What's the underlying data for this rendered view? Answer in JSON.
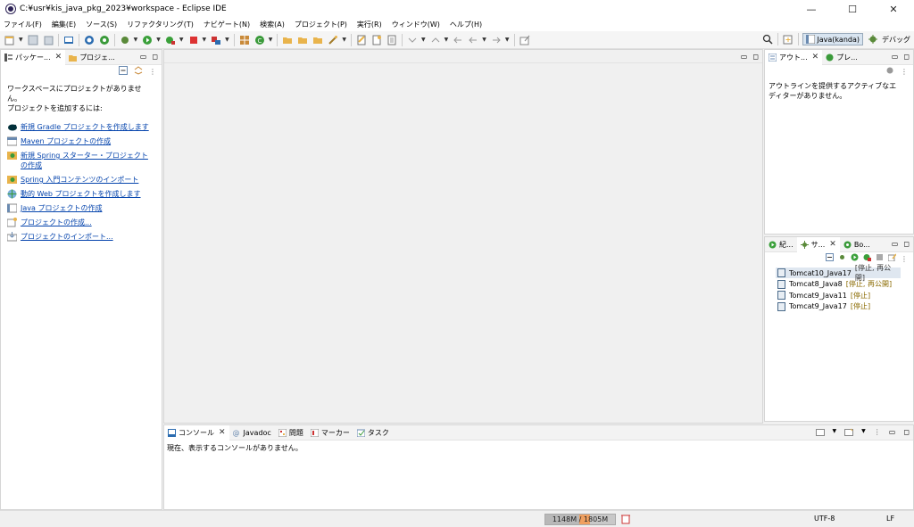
{
  "window": {
    "title": "C:¥usr¥kis_java_pkg_2023¥workspace - Eclipse IDE",
    "minimize_glyph": "—",
    "maximize_glyph": "☐",
    "close_glyph": "✕"
  },
  "menu": [
    "ファイル(F)",
    "編集(E)",
    "ソース(S)",
    "リファクタリング(T)",
    "ナビゲート(N)",
    "検索(A)",
    "プロジェクト(P)",
    "実行(R)",
    "ウィンドウ(W)",
    "ヘルプ(H)"
  ],
  "perspectives": {
    "java": "Java(kanda)",
    "debug": "デバッグ"
  },
  "left_panel": {
    "tab_package": "パッケー...",
    "tab_project": "プロジェ...",
    "empty_msg_1": "ワークスペースにプロジェクトがありません。",
    "empty_msg_2": "プロジェクトを追加するには:",
    "links": [
      "新規 Gradle プロジェクトを作成します",
      "Maven プロジェクトの作成",
      "新規 Spring スターター・プロジェクト",
      "Spring 入門コンテンツのインポート",
      "動的 Web プロジェクトを作成します",
      "Java プロジェクトの作成",
      "プロジェクトの作成...",
      "プロジェクトのインポート..."
    ],
    "link_2_cont": "の作成"
  },
  "outline_panel": {
    "tab_outline": "アウト...",
    "tab_preview": "プレ...",
    "msg_1": "アウトラインを提供するアクティブなエ",
    "msg_2": "ディターがありません。"
  },
  "servers_panel": {
    "tab_1": "紀...",
    "tab_2": "サ...",
    "tab_3": "Bo...",
    "servers": [
      {
        "name": "Tomcat10_Java17",
        "status": "[停止, 再公開]"
      },
      {
        "name": "Tomcat8_Java8",
        "status": "[停止, 再公開]"
      },
      {
        "name": "Tomcat9_Java11",
        "status": "[停止]"
      },
      {
        "name": "Tomcat9_Java17",
        "status": "[停止]"
      }
    ]
  },
  "console_panel": {
    "tab_console": "コンソール",
    "tab_javadoc": "Javadoc",
    "tab_problems": "問題",
    "tab_markers": "マーカー",
    "tab_tasks": "タスク",
    "msg": "現在、表示するコンソールがありません。"
  },
  "statusbar": {
    "heap": "1148M / 1805M",
    "heap_used_fraction": 0.636,
    "encoding": "UTF-8",
    "line_ending": "LF"
  },
  "colors": {
    "accent": "#2c2255",
    "link": "#0645ad",
    "heap_fill": "#f0a060"
  }
}
